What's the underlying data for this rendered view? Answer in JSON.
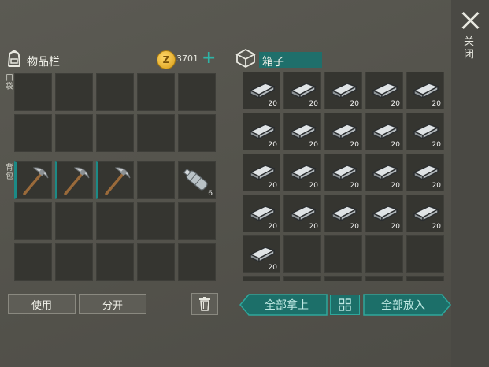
{
  "inventory": {
    "title": "物品栏",
    "coins": "3701",
    "pocket_label": "口袋",
    "backpack_label": "背包",
    "use_label": "使用",
    "split_label": "分开",
    "coin_symbol": "Z",
    "add_symbol": "+",
    "pickaxe_icon": "pickaxe-icon",
    "bottle_icon": "water-bottle-icon",
    "bottle_count": "6"
  },
  "chest": {
    "title": "箱子",
    "take_all_label": "全部拿上",
    "put_all_label": "全部放入",
    "item_icon": "iron-bar-icon",
    "item_count": "20",
    "filled_slots": 21
  },
  "close_label": "关闭",
  "colors": {
    "accent": "#1c8a86",
    "accent_text": "#bfe9e4",
    "coin": "#e8b22d"
  }
}
